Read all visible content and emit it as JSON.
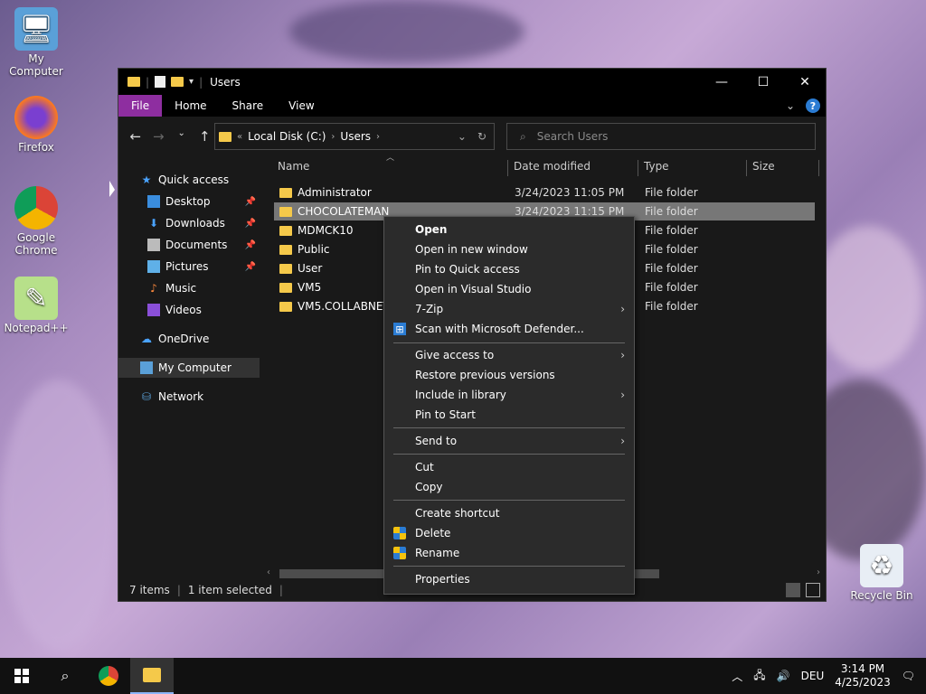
{
  "desktop": {
    "icons": [
      {
        "label": "My Computer"
      },
      {
        "label": "Firefox"
      },
      {
        "label": "Google Chrome"
      },
      {
        "label": "Notepad++"
      },
      {
        "label": "Recycle Bin"
      }
    ]
  },
  "window": {
    "title": "Users",
    "ribbon_tabs": [
      "File",
      "Home",
      "Share",
      "View"
    ],
    "address": {
      "crumbs": [
        "Local Disk (C:)",
        "Users"
      ]
    },
    "search_placeholder": "Search Users",
    "nav_pane": {
      "quick_access": "Quick access",
      "items": [
        "Desktop",
        "Downloads",
        "Documents",
        "Pictures",
        "Music",
        "Videos"
      ],
      "onedrive": "OneDrive",
      "my_computer": "My Computer",
      "network": "Network"
    },
    "columns": [
      "Name",
      "Date modified",
      "Type",
      "Size"
    ],
    "files": [
      {
        "name": "Administrator",
        "date": "3/24/2023 11:05 PM",
        "type": "File folder"
      },
      {
        "name": "CHOCOLATEMAN",
        "date": "3/24/2023 11:15 PM",
        "type": "File folder"
      },
      {
        "name": "MDMCK10",
        "date": "",
        "type": "File folder"
      },
      {
        "name": "Public",
        "date": "",
        "type": "File folder"
      },
      {
        "name": "User",
        "date": "",
        "type": "File folder"
      },
      {
        "name": "VM5",
        "date": "",
        "type": "File folder"
      },
      {
        "name": "VM5.COLLABNET",
        "date": "",
        "type": "File folder"
      }
    ],
    "status": {
      "items": "7 items",
      "selected": "1 item selected"
    }
  },
  "context_menu": {
    "items": [
      {
        "label": "Open"
      },
      {
        "label": "Open in new window"
      },
      {
        "label": "Pin to Quick access"
      },
      {
        "label": "Open in Visual Studio"
      },
      {
        "label": "7-Zip"
      },
      {
        "label": "Scan with Microsoft Defender..."
      },
      {
        "label": "Give access to"
      },
      {
        "label": "Restore previous versions"
      },
      {
        "label": "Include in library"
      },
      {
        "label": "Pin to Start"
      },
      {
        "label": "Send to"
      },
      {
        "label": "Cut"
      },
      {
        "label": "Copy"
      },
      {
        "label": "Create shortcut"
      },
      {
        "label": "Delete"
      },
      {
        "label": "Rename"
      },
      {
        "label": "Properties"
      }
    ]
  },
  "taskbar": {
    "language": "DEU",
    "time": "3:14 PM",
    "date": "4/25/2023"
  },
  "colors": {
    "file_tab": "#8e2ea0",
    "folder": "#f5c94a",
    "accent": "#2b7cd3"
  }
}
